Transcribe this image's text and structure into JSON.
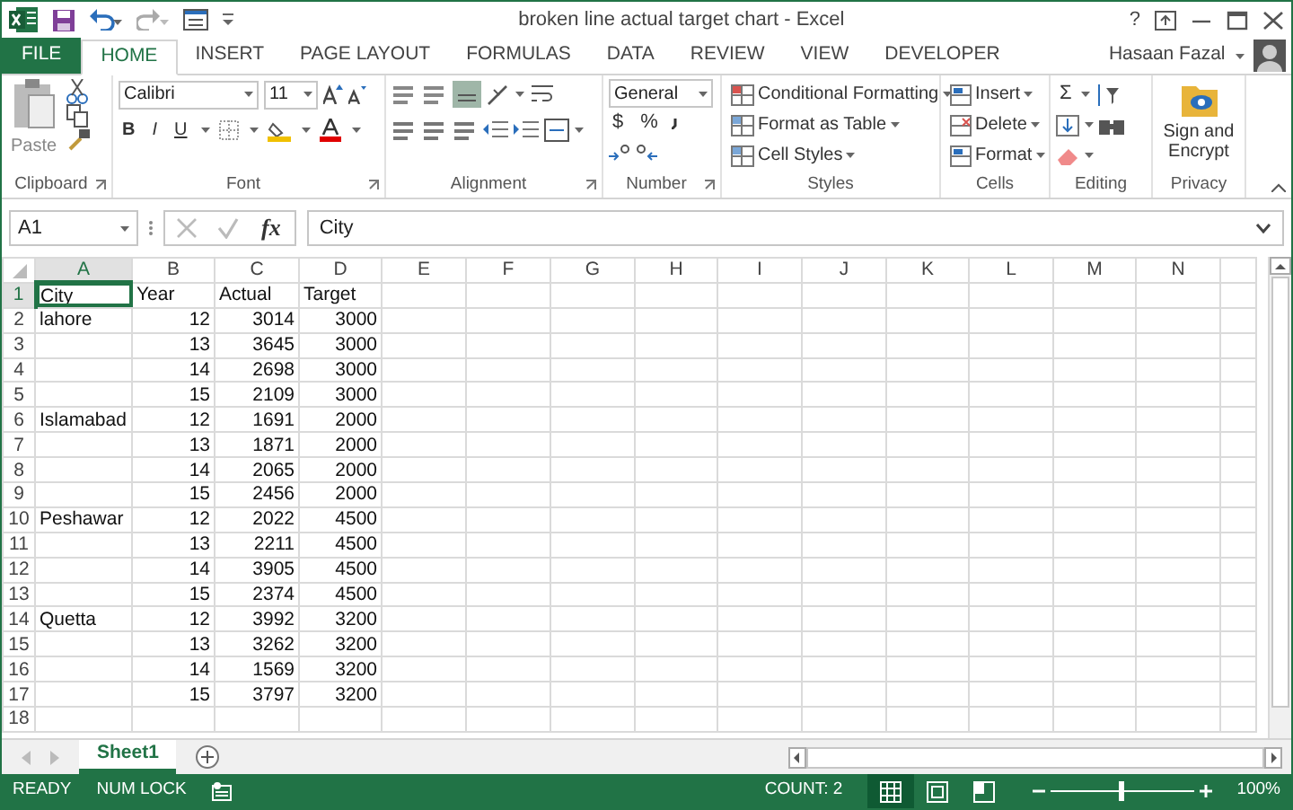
{
  "title_bar": {
    "title": "broken line actual target chart - Excel",
    "help": "?"
  },
  "ribbon_tabs": [
    {
      "label": "FILE",
      "kind": "file",
      "selected": false
    },
    {
      "label": "HOME",
      "kind": "tab",
      "selected": true
    },
    {
      "label": "INSERT",
      "kind": "tab",
      "selected": false
    },
    {
      "label": "PAGE LAYOUT",
      "kind": "tab",
      "selected": false
    },
    {
      "label": "FORMULAS",
      "kind": "tab",
      "selected": false
    },
    {
      "label": "DATA",
      "kind": "tab",
      "selected": false
    },
    {
      "label": "REVIEW",
      "kind": "tab",
      "selected": false
    },
    {
      "label": "VIEW",
      "kind": "tab",
      "selected": false
    },
    {
      "label": "DEVELOPER",
      "kind": "tab",
      "selected": false
    }
  ],
  "user": {
    "name": "Hasaan Fazal"
  },
  "ribbon_groups": [
    {
      "kind": "clipboard",
      "label": "Clipboard",
      "items": [
        "Paste"
      ]
    },
    {
      "kind": "font",
      "label": "Font",
      "items": [
        "Calibri",
        "11",
        "B",
        "I",
        "U"
      ]
    },
    {
      "kind": "alignment",
      "label": "Alignment"
    },
    {
      "kind": "number",
      "label": "Number",
      "items": [
        "General",
        "$",
        "%"
      ]
    },
    {
      "kind": "styles",
      "label": "Styles",
      "items": [
        "Conditional Formatting",
        "Format as Table",
        "Cell Styles"
      ]
    },
    {
      "kind": "cells",
      "label": "Cells",
      "items": [
        "Insert",
        "Delete",
        "Format"
      ]
    },
    {
      "kind": "editing",
      "label": "Editing",
      "items": [
        "Σ"
      ]
    },
    {
      "kind": "privacy",
      "label": "Privacy",
      "items": [
        "Sign and Encrypt"
      ]
    }
  ],
  "formula_bar": {
    "name_box": "A1",
    "function_label": "fx",
    "content": "City"
  },
  "columns": [
    {
      "label": "A",
      "selected": true
    },
    {
      "label": "B",
      "selected": false
    },
    {
      "label": "C",
      "selected": false
    },
    {
      "label": "D",
      "selected": false
    },
    {
      "label": "E",
      "selected": false
    },
    {
      "label": "F",
      "selected": false
    },
    {
      "label": "G",
      "selected": false
    },
    {
      "label": "H",
      "selected": false
    },
    {
      "label": "I",
      "selected": false
    },
    {
      "label": "J",
      "selected": false
    },
    {
      "label": "K",
      "selected": false
    },
    {
      "label": "L",
      "selected": false
    },
    {
      "label": "M",
      "selected": false
    },
    {
      "label": "N",
      "selected": false
    }
  ],
  "rows": [
    {
      "number": "1",
      "kind": "header",
      "selected": true,
      "cells": [
        "City",
        "Year",
        "Actual",
        "Target"
      ]
    },
    {
      "number": "2",
      "kind": "data",
      "selected": false,
      "cells": [
        "lahore",
        "12",
        "3014",
        "3000"
      ]
    },
    {
      "number": "3",
      "kind": "data",
      "selected": false,
      "cells": [
        "",
        "13",
        "3645",
        "3000"
      ]
    },
    {
      "number": "4",
      "kind": "data",
      "selected": false,
      "cells": [
        "",
        "14",
        "2698",
        "3000"
      ]
    },
    {
      "number": "5",
      "kind": "data",
      "selected": false,
      "cells": [
        "",
        "15",
        "2109",
        "3000"
      ]
    },
    {
      "number": "6",
      "kind": "data",
      "selected": false,
      "cells": [
        "Islamabad",
        "12",
        "1691",
        "2000"
      ]
    },
    {
      "number": "7",
      "kind": "data",
      "selected": false,
      "cells": [
        "",
        "13",
        "1871",
        "2000"
      ]
    },
    {
      "number": "8",
      "kind": "data",
      "selected": false,
      "cells": [
        "",
        "14",
        "2065",
        "2000"
      ]
    },
    {
      "number": "9",
      "kind": "data",
      "selected": false,
      "cells": [
        "",
        "15",
        "2456",
        "2000"
      ]
    },
    {
      "number": "10",
      "kind": "data",
      "selected": false,
      "cells": [
        "Peshawar",
        "12",
        "2022",
        "4500"
      ]
    },
    {
      "number": "11",
      "kind": "data",
      "selected": false,
      "cells": [
        "",
        "13",
        "2211",
        "4500"
      ]
    },
    {
      "number": "12",
      "kind": "data",
      "selected": false,
      "cells": [
        "",
        "14",
        "3905",
        "4500"
      ]
    },
    {
      "number": "13",
      "kind": "data",
      "selected": false,
      "cells": [
        "",
        "15",
        "2374",
        "4500"
      ]
    },
    {
      "number": "14",
      "kind": "data",
      "selected": false,
      "cells": [
        "Quetta",
        "12",
        "3992",
        "3200"
      ]
    },
    {
      "number": "15",
      "kind": "data",
      "selected": false,
      "cells": [
        "",
        "13",
        "3262",
        "3200"
      ]
    },
    {
      "number": "16",
      "kind": "data",
      "selected": false,
      "cells": [
        "",
        "14",
        "1569",
        "3200"
      ]
    },
    {
      "number": "17",
      "kind": "data",
      "selected": false,
      "cells": [
        "",
        "15",
        "3797",
        "3200"
      ]
    },
    {
      "number": "18",
      "kind": "data",
      "selected": false,
      "cells": []
    }
  ],
  "sheet_tabs": [
    {
      "label": "Sheet1",
      "selected": true
    }
  ],
  "status_bar": {
    "items": [
      "READY",
      "NUM LOCK"
    ],
    "count": "COUNT: 2",
    "views": [
      {
        "kind": "normal",
        "selected": true
      },
      {
        "kind": "page-layout",
        "selected": false
      },
      {
        "kind": "page-break",
        "selected": false
      }
    ],
    "zoom": {
      "level": 0.5,
      "reading": "100%"
    }
  }
}
